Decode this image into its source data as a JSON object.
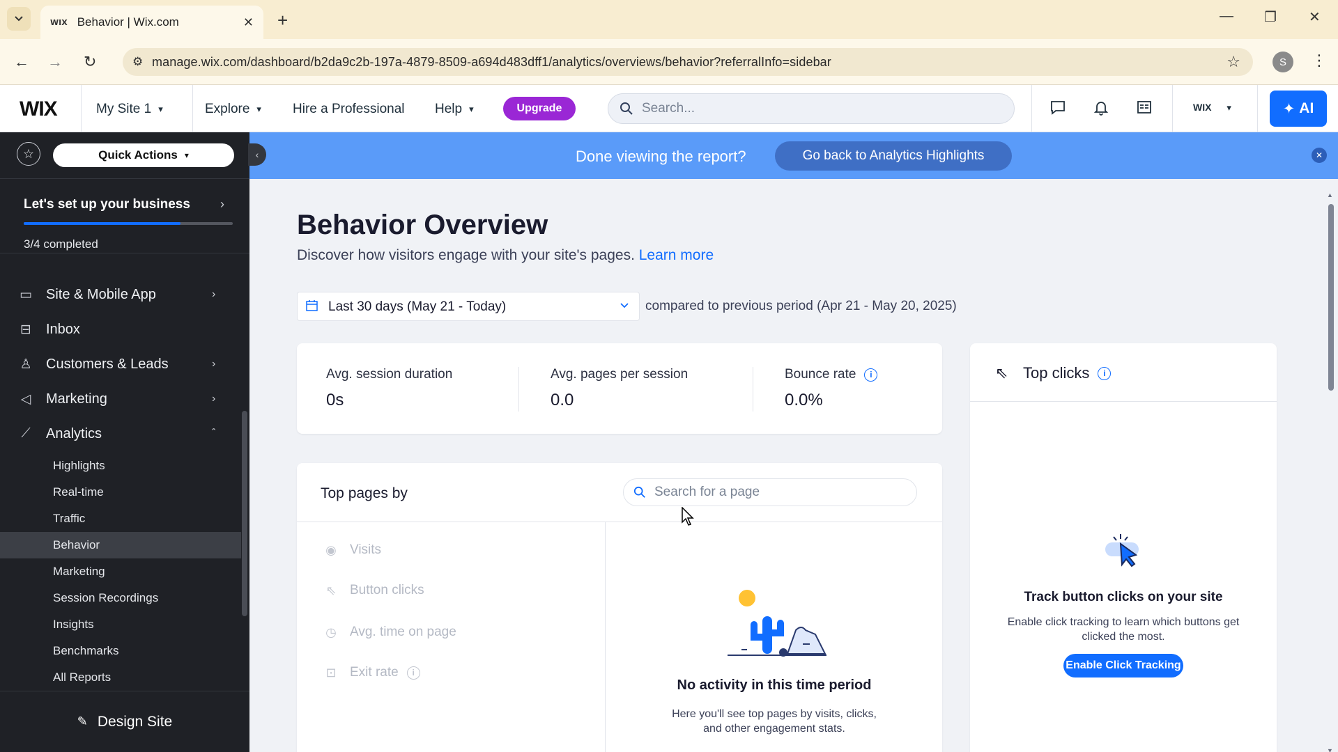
{
  "browser": {
    "tab_title": "Behavior | Wix.com",
    "favicon_text": "WIX",
    "url": "manage.wix.com/dashboard/b2da9c2b-197a-4879-8509-a694d483dff1/analytics/overviews/behavior?referralInfo=sidebar",
    "profile_initial": "S"
  },
  "topbar": {
    "logo": "WIX",
    "site_name": "My Site 1",
    "explore": "Explore",
    "hire": "Hire a Professional",
    "help": "Help",
    "upgrade": "Upgrade",
    "search_placeholder": "Search...",
    "account_logo": "WIX",
    "ai_label": "AI"
  },
  "sidebar": {
    "quick_actions": "Quick Actions",
    "setup_title": "Let's set up your business",
    "setup_progress": 0.75,
    "setup_status": "3/4 completed",
    "items": [
      {
        "label": "Site & Mobile App",
        "icon": "monitor-icon",
        "has_children": true
      },
      {
        "label": "Inbox",
        "icon": "inbox-icon",
        "has_children": false
      },
      {
        "label": "Customers & Leads",
        "icon": "customers-icon",
        "has_children": true
      },
      {
        "label": "Marketing",
        "icon": "megaphone-icon",
        "has_children": true
      },
      {
        "label": "Analytics",
        "icon": "chart-icon",
        "has_children": true,
        "expanded": true
      }
    ],
    "analytics_subitems": [
      {
        "label": "Highlights"
      },
      {
        "label": "Real-time"
      },
      {
        "label": "Traffic"
      },
      {
        "label": "Behavior",
        "active": true
      },
      {
        "label": "Marketing"
      },
      {
        "label": "Session Recordings"
      },
      {
        "label": "Insights"
      },
      {
        "label": "Benchmarks"
      },
      {
        "label": "All Reports"
      }
    ],
    "design_site": "Design Site"
  },
  "banner": {
    "text": "Done viewing the report?",
    "button": "Go back to Analytics Highlights"
  },
  "main": {
    "title": "Behavior Overview",
    "subtitle": "Discover how visitors engage with your site's pages.",
    "learn_more": "Learn more",
    "date_range": "Last 30 days (May 21 - Today)",
    "compare": "compared to previous period (Apr 21 - May 20, 2025)",
    "stats": [
      {
        "label": "Avg. session duration",
        "value": "0s"
      },
      {
        "label": "Avg. pages per session",
        "value": "0.0"
      },
      {
        "label": "Bounce rate",
        "value": "0.0%"
      }
    ],
    "top_pages": {
      "title": "Top pages by",
      "search_placeholder": "Search for a page",
      "metrics": [
        "Visits",
        "Button clicks",
        "Avg. time on page",
        "Exit rate"
      ],
      "empty_title": "No activity in this time period",
      "empty_sub": "Here you'll see top pages by visits, clicks, and other engagement stats."
    },
    "top_clicks": {
      "title": "Top clicks",
      "empty_title": "Track button clicks on your site",
      "empty_sub": "Enable click tracking to learn which buttons get clicked the most.",
      "button": "Enable Click Tracking"
    }
  },
  "colors": {
    "accent": "#116dff",
    "upgrade": "#9a27d5",
    "banner": "#5a9bf9",
    "sidebar_bg": "#1f2126"
  }
}
